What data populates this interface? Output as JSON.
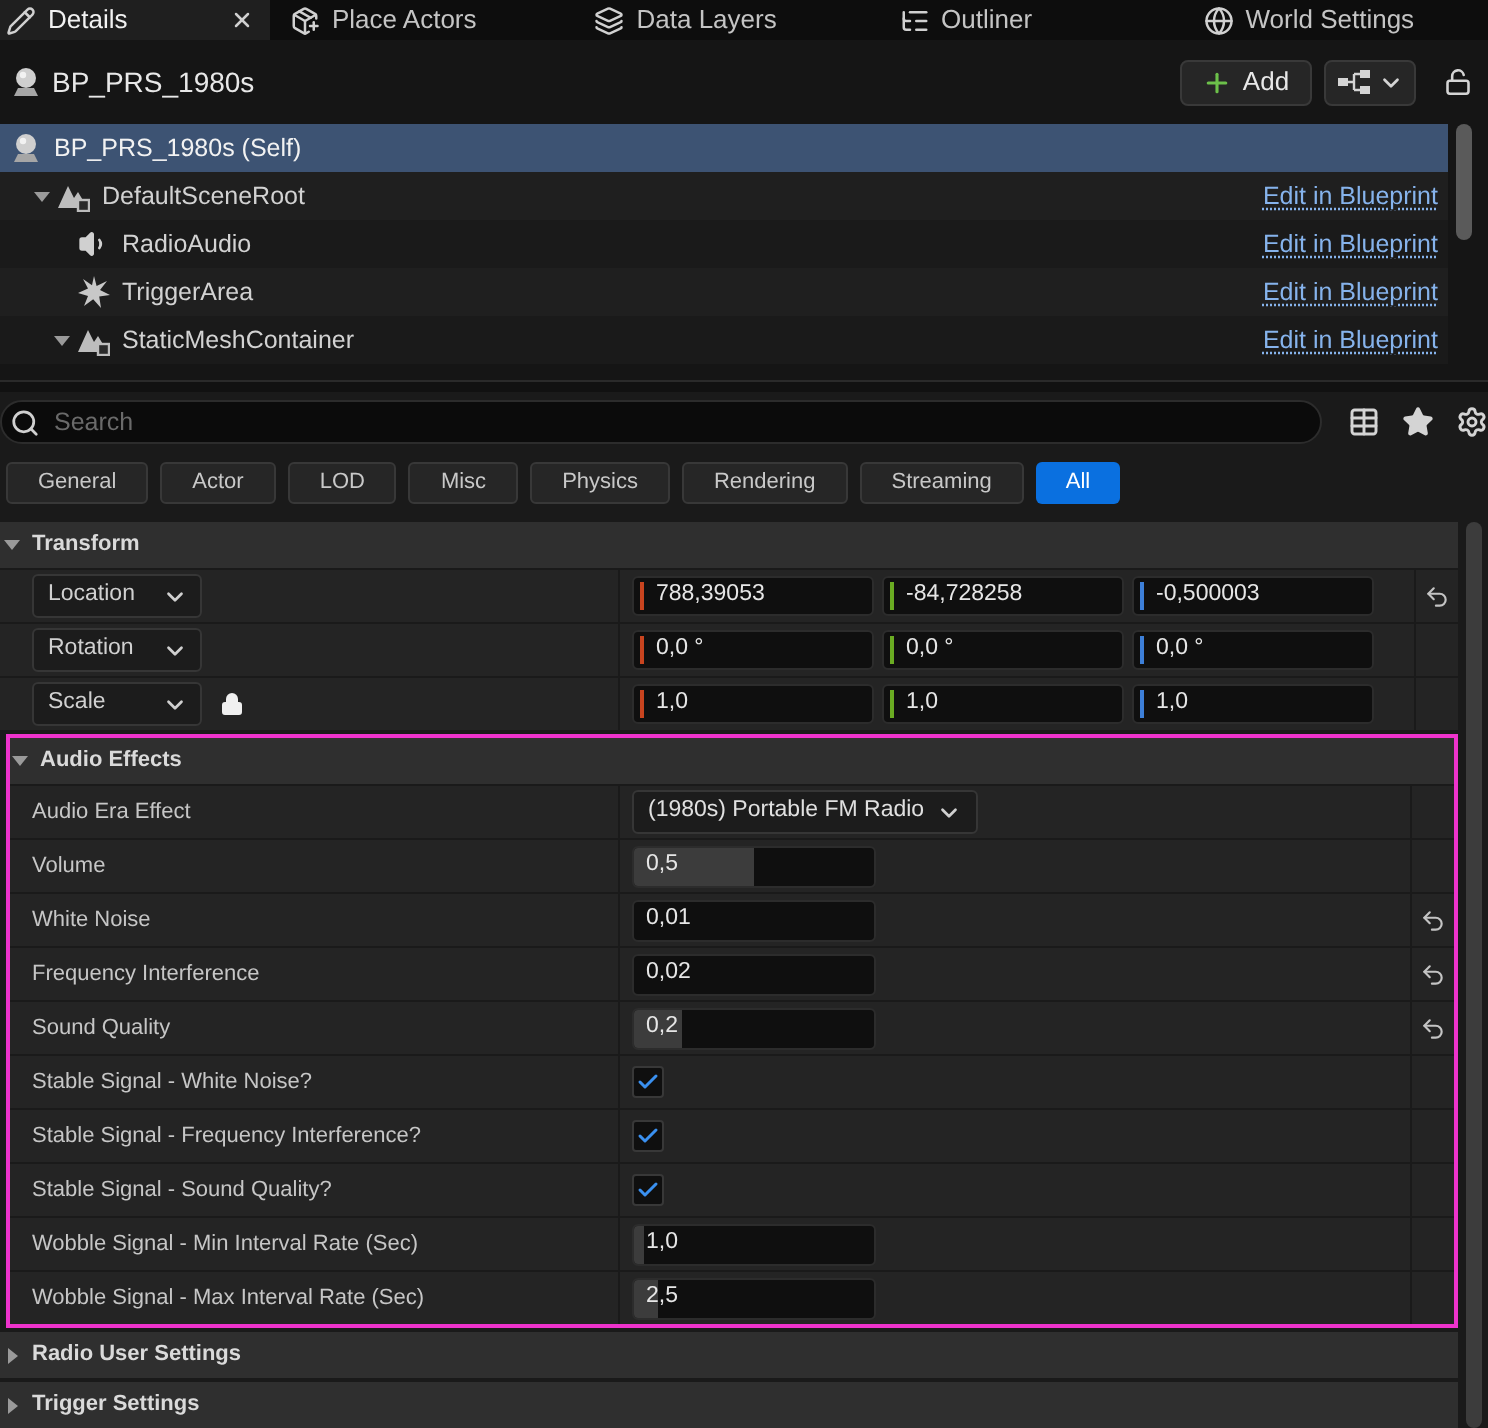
{
  "tabs": [
    {
      "label": "Details",
      "kind": "details",
      "selected": true,
      "closable": true
    },
    {
      "label": "Place Actors",
      "kind": "place",
      "selected": false,
      "closable": false
    },
    {
      "label": "Data Layers",
      "kind": "layers",
      "selected": false,
      "closable": false
    },
    {
      "label": "Outliner",
      "kind": "outliner",
      "selected": false,
      "closable": false
    },
    {
      "label": "World Settings",
      "kind": "world",
      "selected": false,
      "closable": false
    }
  ],
  "header": {
    "title": "BP_PRS_1980s",
    "add_button": "Add"
  },
  "components": [
    {
      "label": "BP_PRS_1980s (Self)",
      "kind": "actor",
      "selected": true,
      "children": [
        {
          "label": "DefaultSceneRoot",
          "kind": "scene",
          "selected": false,
          "expanded": true,
          "link": "Edit in Blueprint",
          "children": [
            {
              "label": "RadioAudio",
              "kind": "audio",
              "selected": false,
              "link": "Edit in Blueprint"
            },
            {
              "label": "TriggerArea",
              "kind": "trigger",
              "selected": false,
              "link": "Edit in Blueprint"
            },
            {
              "label": "StaticMeshContainer",
              "kind": "scene",
              "selected": false,
              "expanded": true,
              "link": "Edit in Blueprint"
            }
          ]
        }
      ]
    }
  ],
  "search": {
    "placeholder": "Search"
  },
  "filters": [
    {
      "label": "General",
      "selected": false
    },
    {
      "label": "Actor",
      "selected": false
    },
    {
      "label": "LOD",
      "selected": false
    },
    {
      "label": "Misc",
      "selected": false
    },
    {
      "label": "Physics",
      "selected": false
    },
    {
      "label": "Rendering",
      "selected": false
    },
    {
      "label": "Streaming",
      "selected": false
    },
    {
      "label": "All",
      "selected": true
    }
  ],
  "sections": [
    {
      "title": "Transform",
      "expanded": true,
      "highlighted": false,
      "rows": [
        {
          "kind": "vector",
          "label": "Location",
          "lock": false,
          "reset": true,
          "values": [
            {
              "value": "788,39053",
              "color": "#c8441f"
            },
            {
              "value": "-84,728258",
              "color": "#6aab22"
            },
            {
              "value": "-0,500003",
              "color": "#3d7fd8"
            }
          ]
        },
        {
          "kind": "vector",
          "label": "Rotation",
          "lock": false,
          "reset": false,
          "values": [
            {
              "value": "0,0 °",
              "color": "#c8441f"
            },
            {
              "value": "0,0 °",
              "color": "#6aab22"
            },
            {
              "value": "0,0 °",
              "color": "#3d7fd8"
            }
          ]
        },
        {
          "kind": "vector",
          "label": "Scale",
          "lock": true,
          "reset": false,
          "values": [
            {
              "value": "1,0",
              "color": "#c8441f"
            },
            {
              "value": "1,0",
              "color": "#6aab22"
            },
            {
              "value": "1,0",
              "color": "#3d7fd8"
            }
          ]
        }
      ]
    },
    {
      "title": "Audio Effects",
      "expanded": true,
      "highlighted": true,
      "rows": [
        {
          "kind": "dropdown",
          "label": "Audio Era Effect",
          "value": "(1980s) Portable FM Radio",
          "reset": false
        },
        {
          "kind": "slider",
          "label": "Volume",
          "value": "0,5",
          "level": 0.5,
          "reset": false
        },
        {
          "kind": "number",
          "label": "White Noise",
          "value": "0,01",
          "reset": true
        },
        {
          "kind": "number",
          "label": "Frequency Interference",
          "value": "0,02",
          "reset": true
        },
        {
          "kind": "slider",
          "label": "Sound Quality",
          "value": "0,2",
          "level": 0.2,
          "reset": true
        },
        {
          "kind": "checkbox",
          "label": "Stable Signal - White Noise?",
          "checked": true,
          "reset": false
        },
        {
          "kind": "checkbox",
          "label": "Stable Signal - Frequency Interference?",
          "checked": true,
          "reset": false
        },
        {
          "kind": "checkbox",
          "label": "Stable Signal - Sound Quality?",
          "checked": true,
          "reset": false
        },
        {
          "kind": "slider",
          "label": "Wobble Signal - Min Interval Rate (Sec)",
          "value": "1,0",
          "level": 0.04,
          "reset": false
        },
        {
          "kind": "slider",
          "label": "Wobble Signal - Max Interval Rate (Sec)",
          "value": "2,5",
          "level": 0.1,
          "reset": false
        }
      ]
    },
    {
      "title": "Radio User Settings",
      "expanded": false,
      "highlighted": false
    },
    {
      "title": "Trigger Settings",
      "expanded": false,
      "highlighted": false
    }
  ]
}
